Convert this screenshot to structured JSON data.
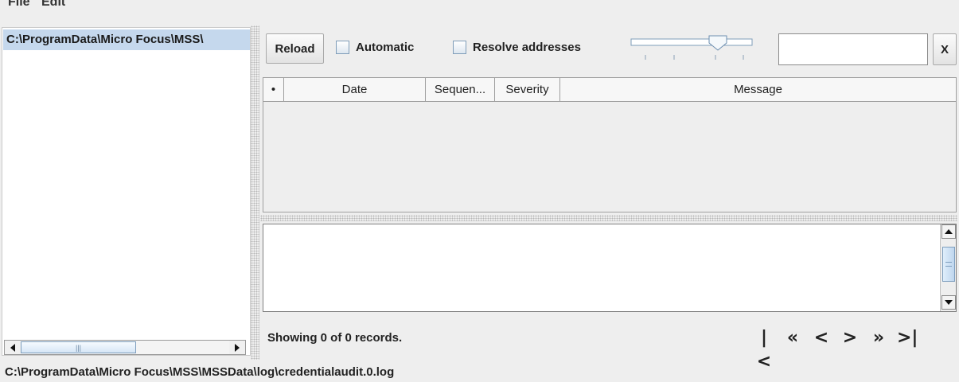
{
  "menu": {
    "file": "File",
    "edit": "Edit"
  },
  "left": {
    "selected_path": "C:\\ProgramData\\Micro Focus\\MSS\\"
  },
  "toolbar": {
    "reload_label": "Reload",
    "automatic_label": "Automatic",
    "automatic_checked": false,
    "resolve_label": "Resolve addresses",
    "resolve_checked": false,
    "filter_value": "",
    "clear_label": "X"
  },
  "table": {
    "columns": [
      "•",
      "Date",
      "Sequen...",
      "Severity",
      "Message"
    ],
    "rows": []
  },
  "status": {
    "records_text": "Showing 0 of 0 records."
  },
  "pager": {
    "first": "|<",
    "prev_page": "«",
    "prev": "<",
    "next": ">",
    "next_page": "»",
    "last": ">|"
  },
  "statusbar": {
    "path": "C:\\ProgramData\\Micro Focus\\MSS\\MSSData\\log\\credentialaudit.0.log"
  }
}
